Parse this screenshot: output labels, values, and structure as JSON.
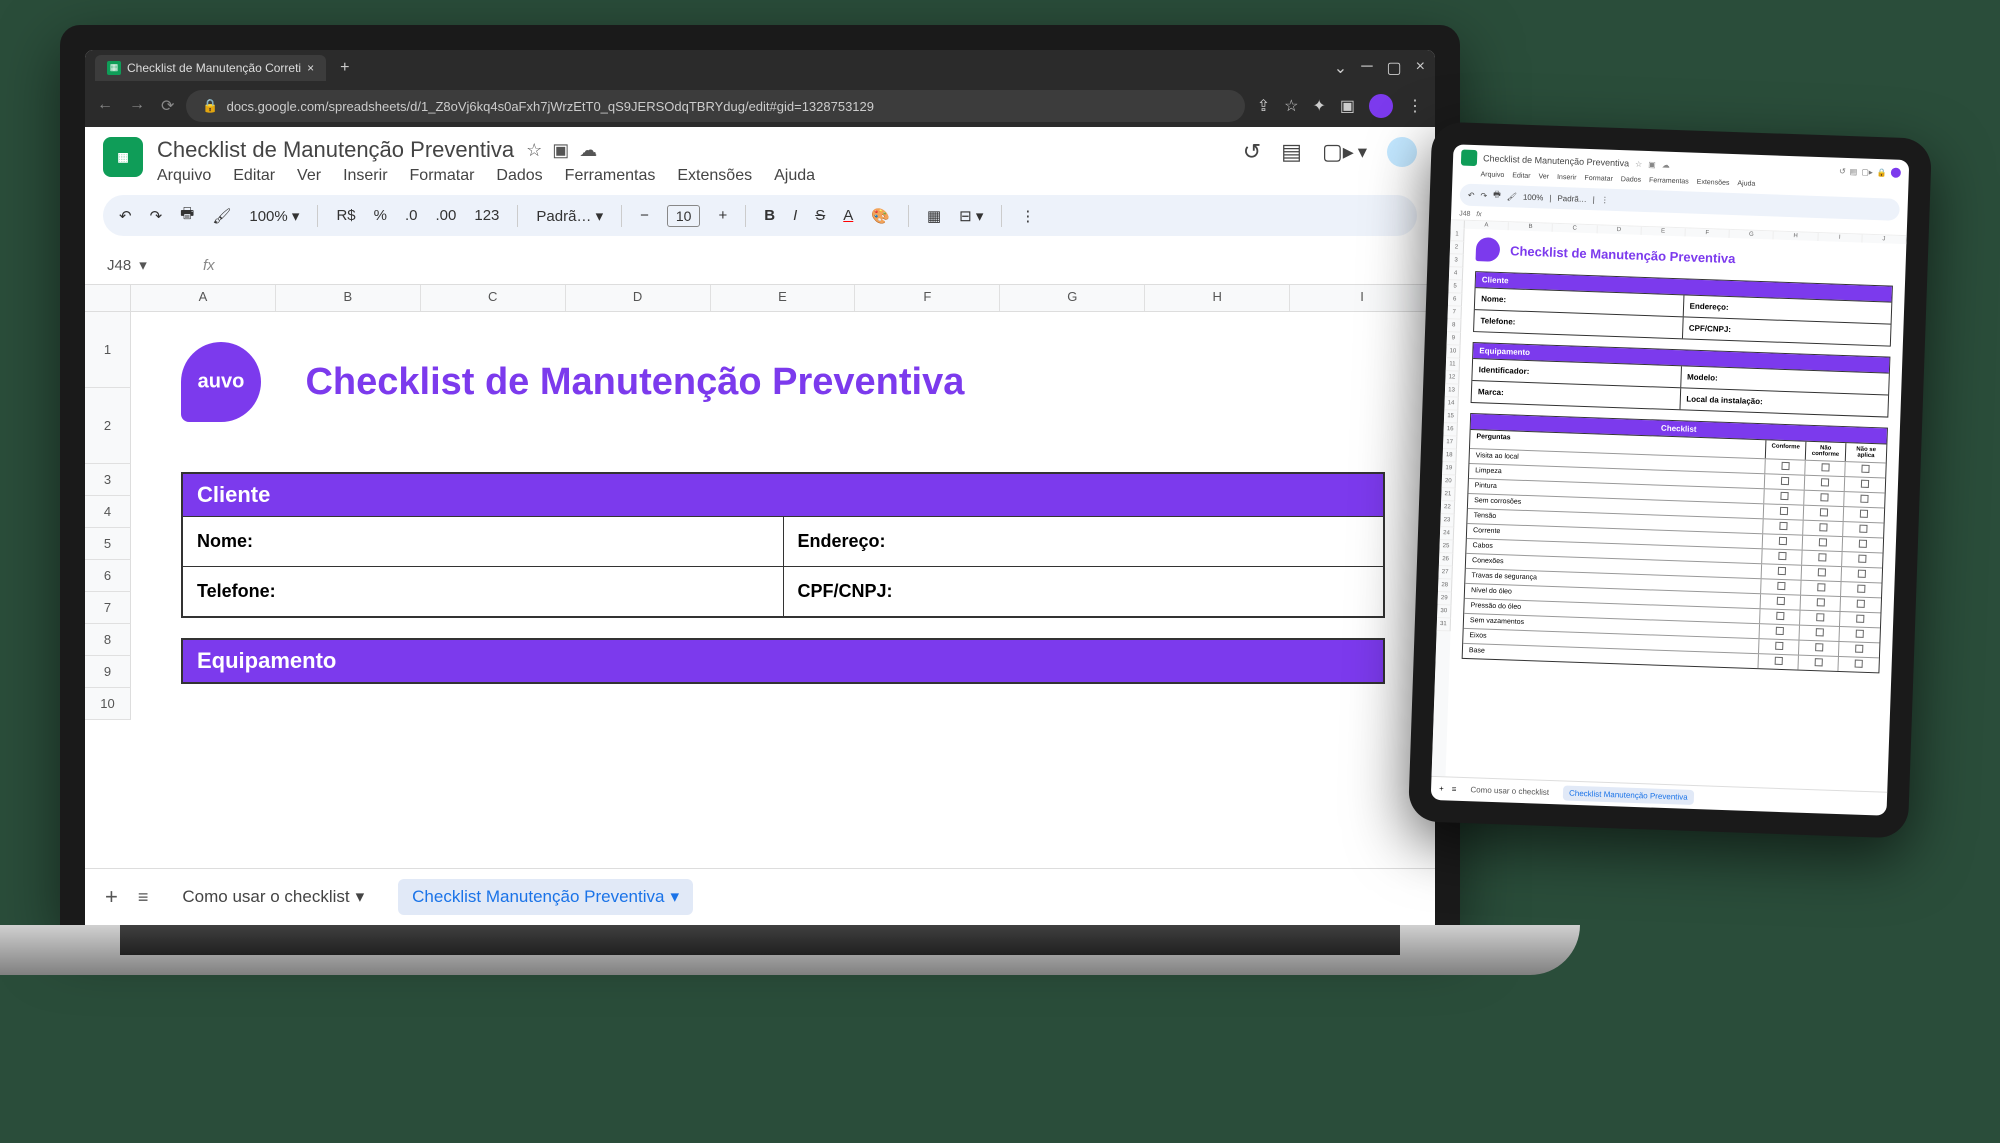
{
  "browser": {
    "tab_title": "Checklist de Manutenção Correti",
    "url": "docs.google.com/spreadsheets/d/1_Z8oVj6kq4s0aFxh7jWrzEtT0_qS9JERSOdqTBRYdug/edit#gid=1328753129"
  },
  "sheets": {
    "doc_title": "Checklist de Manutenção Preventiva",
    "menus": [
      "Arquivo",
      "Editar",
      "Ver",
      "Inserir",
      "Formatar",
      "Dados",
      "Ferramentas",
      "Extensões",
      "Ajuda"
    ],
    "zoom": "100%",
    "currency": "R$",
    "percent": "%",
    "decimal_dec": ".0",
    "decimal_inc": ".00",
    "num_format": "123",
    "font": "Padrã…",
    "font_size": "10",
    "name_box": "J48",
    "fx_label": "fx",
    "columns": [
      "A",
      "B",
      "C",
      "D",
      "E",
      "F",
      "G",
      "H",
      "I"
    ],
    "rows_laptop": [
      "1",
      "2",
      "3",
      "4",
      "5",
      "6",
      "7",
      "8",
      "9",
      "10"
    ],
    "tabs": {
      "tab1": "Como usar o checklist",
      "tab2": "Checklist Manutenção Preventiva"
    }
  },
  "content": {
    "logo_text": "auvo",
    "title": "Checklist de Manutenção Preventiva",
    "section_cliente": {
      "header": "Cliente",
      "nome": "Nome:",
      "endereco": "Endereço:",
      "telefone": "Telefone:",
      "cpf": "CPF/CNPJ:"
    },
    "section_equip": {
      "header": "Equipamento",
      "identificador": "Identificador:",
      "modelo": "Modelo:",
      "marca": "Marca:",
      "local": "Local da instalação:"
    },
    "checklist": {
      "header": "Checklist",
      "col_perguntas": "Perguntas",
      "col_conforme": "Conforme",
      "col_nao_conforme": "Não conforme",
      "col_nao_aplica": "Não se aplica",
      "items": [
        "Visita ao local",
        "Limpeza",
        "Pintura",
        "Sem corrosões",
        "Tensão",
        "Corrente",
        "Cabos",
        "Conexões",
        "Travas de segurança",
        "Nível do óleo",
        "Pressão do óleo",
        "Sem vazamentos",
        "Eixos",
        "Base"
      ]
    }
  },
  "tablet": {
    "doc_title": "Checklist de Manutenção Preventiva",
    "menus": [
      "Arquivo",
      "Editar",
      "Ver",
      "Inserir",
      "Formatar",
      "Dados",
      "Ferramentas",
      "Extensões",
      "Ajuda"
    ],
    "zoom": "100%",
    "font": "Padrã…",
    "name_box": "J48",
    "columns": [
      "A",
      "B",
      "C",
      "D",
      "E",
      "F",
      "G",
      "H",
      "I",
      "J"
    ],
    "rows": [
      "1",
      "2",
      "3",
      "4",
      "5",
      "6",
      "7",
      "8",
      "9",
      "10",
      "11",
      "12",
      "13",
      "14",
      "15",
      "16",
      "17",
      "18",
      "19",
      "20",
      "21",
      "22",
      "23",
      "24",
      "25",
      "26",
      "27",
      "28",
      "29",
      "30",
      "31"
    ]
  }
}
